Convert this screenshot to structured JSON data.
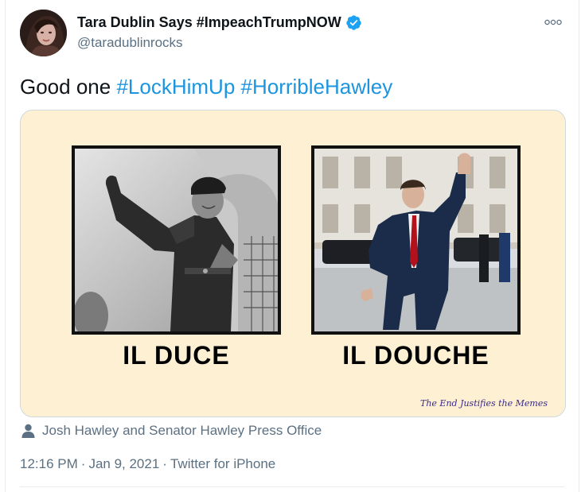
{
  "author": {
    "display_name": "Tara Dublin Says #ImpeachTrumpNOW",
    "handle": "@taradublinrocks",
    "verified_color": "#1da1f2"
  },
  "tweet": {
    "text_plain": "Good one",
    "hashtags": [
      "#LockHimUp",
      "#HorribleHawley"
    ],
    "hashtag_color": "#1b95e0"
  },
  "media": {
    "background_color": "#fdf0d3",
    "left_caption": "IL DUCE",
    "right_caption": "IL DOUCHE",
    "watermark": "The End Justifies the Memes"
  },
  "credit": {
    "icon": "person-icon",
    "text": "Josh Hawley and Senator Hawley Press Office"
  },
  "meta": {
    "time": "12:16 PM",
    "date": "Jan 9, 2021",
    "source": "Twitter for iPhone",
    "separator": "·"
  },
  "icons": {
    "more": "more-options-icon",
    "verified": "verified-badge-icon"
  }
}
